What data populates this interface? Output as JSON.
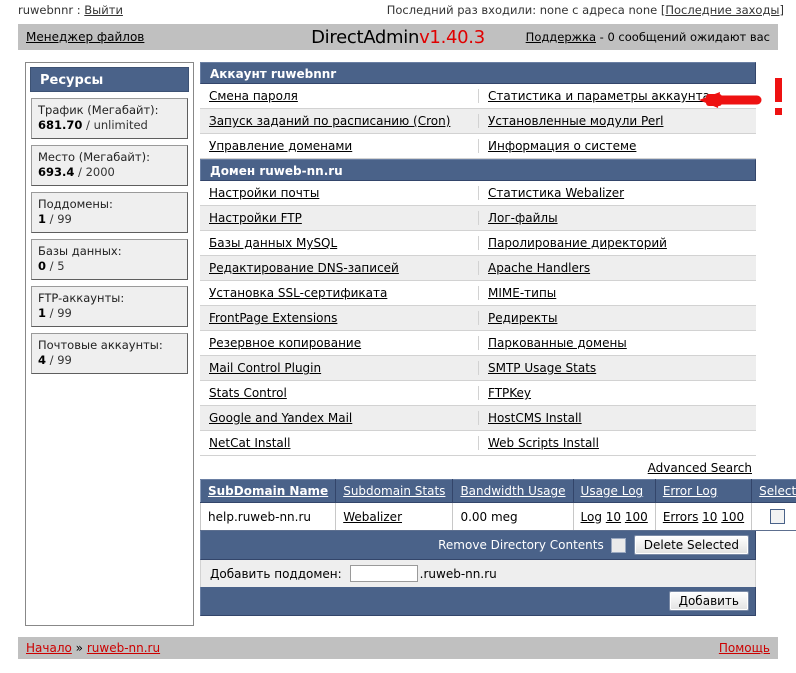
{
  "topbar": {
    "user": "ruwebnnr",
    "sep": ":",
    "logout": "Выйти",
    "last_login_text": "Последний раз входили: none с адреса none",
    "last_logins_bracket_open": "[",
    "last_logins_link": "Последние заходы",
    "last_logins_bracket_close": "]"
  },
  "navbar": {
    "file_manager": "Менеджер файлов",
    "brand_name": "DirectAdmin",
    "brand_version": "v1.40.3",
    "support_link": "Поддержка",
    "support_text": "- 0 сообщений ожидают вас"
  },
  "sidebar": {
    "title": "Ресурсы",
    "items": [
      {
        "label": "Трафик (Мегабайт):",
        "value": "681.70",
        "sep": " / ",
        "limit": "unlimited"
      },
      {
        "label": "Место (Мегабайт):",
        "value": "693.4",
        "sep": " / ",
        "limit": "2000"
      },
      {
        "label": "Поддомены:",
        "value": "1",
        "sep": " / ",
        "limit": "99"
      },
      {
        "label": "Базы данных:",
        "value": "0",
        "sep": " / ",
        "limit": "5"
      },
      {
        "label": "FTP-аккаунты:",
        "value": "1",
        "sep": " / ",
        "limit": "99"
      },
      {
        "label": "Почтовые аккаунты:",
        "value": "4",
        "sep": " / ",
        "limit": "99"
      }
    ]
  },
  "account_section": {
    "title": "Аккаунт ruwebnnr",
    "rows": [
      {
        "left": "Смена пароля",
        "right": "Статистика и параметры аккаунта"
      },
      {
        "left": "Запуск заданий по расписанию (Cron)",
        "right": "Установленные модули Perl"
      },
      {
        "left": "Управление доменами",
        "right": "Информация о системе"
      }
    ]
  },
  "domain_section": {
    "title": "Домен ruweb-nn.ru",
    "rows": [
      {
        "left": "Настройки почты",
        "right": "Статистика Webalizer"
      },
      {
        "left": "Настройки FTP",
        "right": "Лог-файлы"
      },
      {
        "left": "Базы данных MySQL",
        "right": "Паролирование директорий"
      },
      {
        "left": "Редактирование DNS-записей",
        "right": "Apache Handlers"
      },
      {
        "left": "Установка SSL-сертификата",
        "right": "MIME-типы"
      },
      {
        "left": "FrontPage Extensions",
        "right": "Редиректы"
      },
      {
        "left": "Резервное копирование",
        "right": "Паркованные домены"
      },
      {
        "left": "Mail Control Plugin",
        "right": "SMTP Usage Stats"
      },
      {
        "left": "Stats Control",
        "right": "FTPKey"
      },
      {
        "left": "Google and Yandex Mail",
        "right": "HostCMS Install"
      },
      {
        "left": "NetCat Install",
        "right": "Web Scripts Install"
      }
    ]
  },
  "advanced_search": "Advanced Search",
  "subdomain_table": {
    "headers": [
      "SubDomain Name",
      "Subdomain Stats",
      "Bandwidth Usage",
      "Usage Log",
      "Error Log",
      "Select"
    ],
    "rows": [
      {
        "name": "help.ruweb-nn.ru",
        "stats_link": "Webalizer",
        "bandwidth": "0.00 meg",
        "usage_log": {
          "label": "Log",
          "n10": "10",
          "n100": "100"
        },
        "error_log": {
          "label": "Errors",
          "n10": "10",
          "n100": "100"
        }
      }
    ],
    "footer": {
      "remove_contents_label": "Remove Directory Contents",
      "delete_button": "Delete Selected"
    }
  },
  "add_subdomain": {
    "label": "Добавить поддомен:",
    "value": "",
    "placeholder": "",
    "suffix": ".ruweb-nn.ru",
    "submit": "Добавить"
  },
  "footer": {
    "home": "Начало",
    "separator": "»",
    "domain": "ruweb-nn.ru",
    "help": "Помощь"
  },
  "annotation": {
    "shape": "left-arrow",
    "marker": "exclamation-mark",
    "color": "#ee1111"
  },
  "colors": {
    "header_blue": "#4a6289",
    "navbar_gray": "#c0c0c0",
    "row_alt": "#eeeeee",
    "brand_red": "#e00000",
    "footer_link_red": "#cc0000",
    "annotation_red": "#ee1111"
  }
}
